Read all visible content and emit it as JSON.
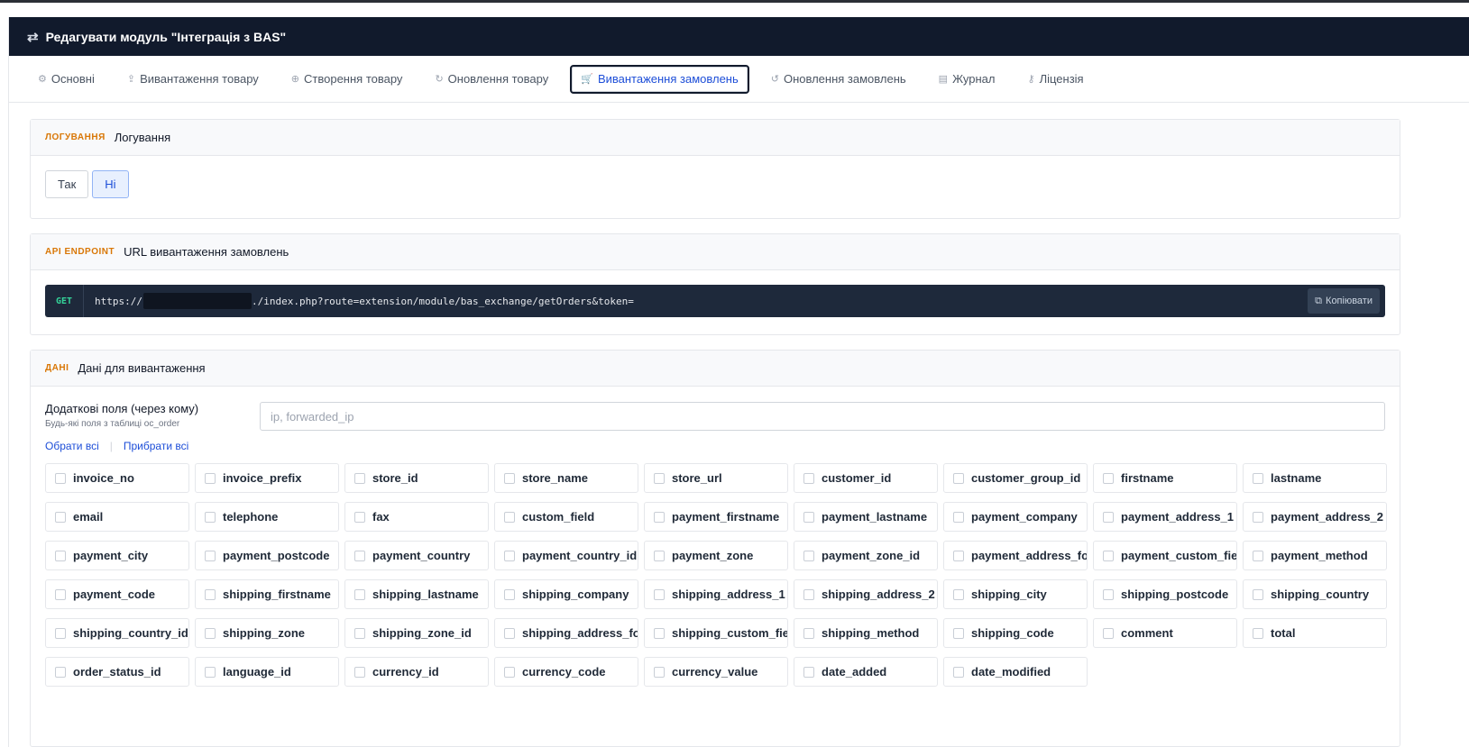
{
  "header": {
    "title": "Редагувати модуль \"Інтеграція з BAS\"",
    "icon": "arrows-swap-icon"
  },
  "tabs": [
    {
      "label": "Основні",
      "icon": "gear-icon",
      "active": false
    },
    {
      "label": "Вивантаження товару",
      "icon": "upload-icon",
      "active": false
    },
    {
      "label": "Створення товару",
      "icon": "plus-circle-icon",
      "active": false
    },
    {
      "label": "Оновлення товару",
      "icon": "refresh-icon",
      "active": false
    },
    {
      "label": "Вивантаження замовлень",
      "icon": "cart-icon",
      "active": true
    },
    {
      "label": "Оновлення замовлень",
      "icon": "history-icon",
      "active": false
    },
    {
      "label": "Журнал",
      "icon": "file-icon",
      "active": false
    },
    {
      "label": "Ліцензія",
      "icon": "key-icon",
      "active": false
    }
  ],
  "logging": {
    "tag": "ЛОГУВАННЯ",
    "title": "Логування",
    "yes": "Так",
    "no": "Ні",
    "selected": "Ні"
  },
  "api": {
    "tag": "API ENDPOINT",
    "title": "URL вивантаження замовлень",
    "method": "GET",
    "url_prefix": "https://",
    "url_suffix": "./index.php?route=extension/module/bas_exchange/getOrders&token=",
    "copy_label": "Копіювати"
  },
  "data": {
    "tag": "ДАНІ",
    "title": "Дані для вивантаження",
    "extra_label": "Додаткові поля (через кому)",
    "extra_hint": "Будь-які поля з таблиці oc_order",
    "extra_placeholder": "ip, forwarded_ip",
    "select_all": "Обрати всі",
    "deselect_all": "Прибрати всі",
    "fields": [
      "invoice_no",
      "invoice_prefix",
      "store_id",
      "store_name",
      "store_url",
      "customer_id",
      "customer_group_id",
      "firstname",
      "lastname",
      "email",
      "telephone",
      "fax",
      "custom_field",
      "payment_firstname",
      "payment_lastname",
      "payment_company",
      "payment_address_1",
      "payment_address_2",
      "payment_city",
      "payment_postcode",
      "payment_country",
      "payment_country_id",
      "payment_zone",
      "payment_zone_id",
      "payment_address_format",
      "payment_custom_field",
      "payment_method",
      "payment_code",
      "shipping_firstname",
      "shipping_lastname",
      "shipping_company",
      "shipping_address_1",
      "shipping_address_2",
      "shipping_city",
      "shipping_postcode",
      "shipping_country",
      "shipping_country_id",
      "shipping_zone",
      "shipping_zone_id",
      "shipping_address_format",
      "shipping_custom_field",
      "shipping_method",
      "shipping_code",
      "comment",
      "total",
      "order_status_id",
      "language_id",
      "currency_id",
      "currency_code",
      "currency_value",
      "date_added",
      "date_modified"
    ]
  },
  "colors": {
    "header_bg": "#111a2c",
    "accent": "#1d4ed8",
    "tag": "#d97706",
    "endpoint_bg": "#1e293b",
    "method": "#34d399"
  }
}
